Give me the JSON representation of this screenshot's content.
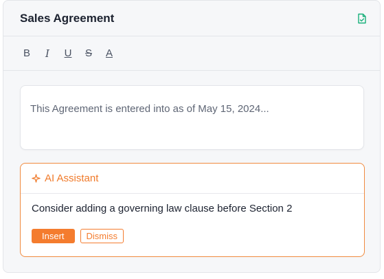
{
  "header": {
    "title": "Sales Agreement",
    "save_icon": "file-check-icon"
  },
  "toolbar": {
    "bold_label": "B",
    "italic_label": "I",
    "underline_label": "U",
    "strike_label": "S",
    "color_label": "A"
  },
  "editor": {
    "content": "This Agreement is entered into as of May 15, 2024..."
  },
  "ai_assistant": {
    "title": "AI Assistant",
    "icon": "sparkle-icon",
    "suggestion": "Consider adding a governing law clause before Section 2",
    "insert_label": "Insert",
    "dismiss_label": "Dismiss"
  },
  "colors": {
    "accent": "#f47c2e",
    "save_icon": "#18b07a"
  }
}
